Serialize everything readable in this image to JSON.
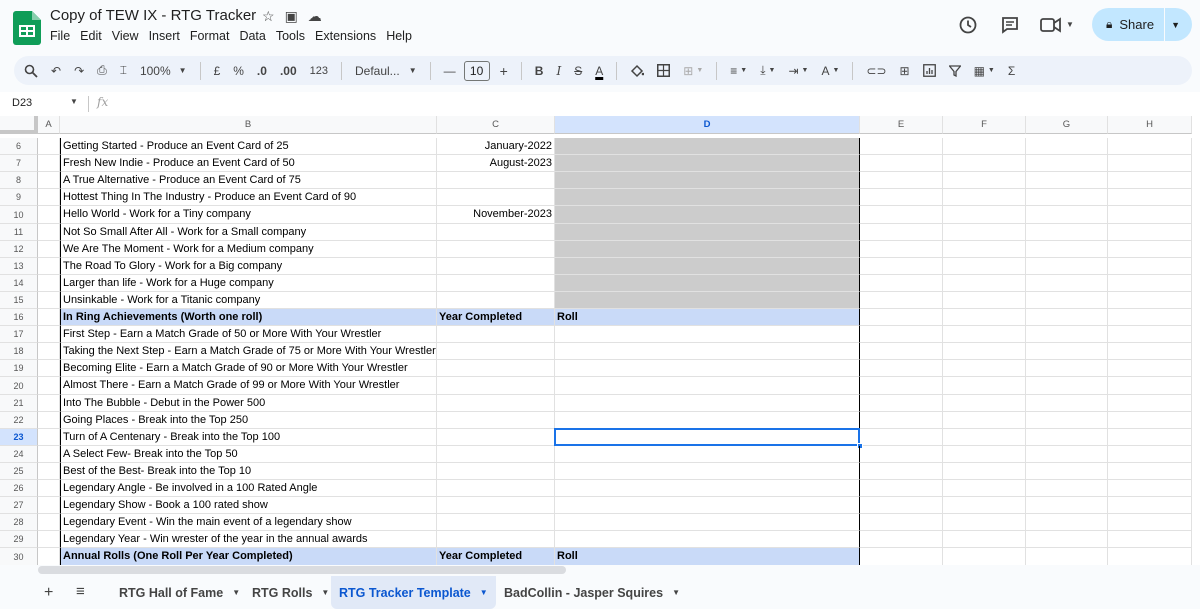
{
  "app": {
    "title": "Copy of TEW IX - RTG Tracker",
    "menu": [
      "File",
      "Edit",
      "View",
      "Insert",
      "Format",
      "Data",
      "Tools",
      "Extensions",
      "Help"
    ],
    "share_label": "Share"
  },
  "toolbar": {
    "zoom": "100%",
    "currency": "£",
    "percent": "%",
    "dec_decrease": ".0",
    "dec_increase": ".00",
    "format_123": "123",
    "font": "Defaul...",
    "font_size": "10",
    "minus": "—",
    "plus": "+",
    "bold": "B",
    "italic": "I",
    "strike": "S",
    "text_color": "A"
  },
  "formula_bar": {
    "cell_ref": "D23",
    "fx": "fx",
    "value": ""
  },
  "columns": [
    {
      "id": "A",
      "selected": false
    },
    {
      "id": "B",
      "selected": false
    },
    {
      "id": "C",
      "selected": false
    },
    {
      "id": "D",
      "selected": true
    },
    {
      "id": "E",
      "selected": false
    },
    {
      "id": "F",
      "selected": false
    },
    {
      "id": "G",
      "selected": false
    },
    {
      "id": "H",
      "selected": false
    }
  ],
  "rows": [
    {
      "n": "6",
      "b": "Getting Started - Produce an Event Card of 25",
      "c": "January-2022",
      "d": "",
      "type": "gray"
    },
    {
      "n": "7",
      "b": "Fresh New Indie - Produce an Event Card of 50",
      "c": "August-2023",
      "d": "",
      "type": "gray"
    },
    {
      "n": "8",
      "b": "A True Alternative - Produce an Event Card of 75",
      "c": "",
      "d": "",
      "type": "gray"
    },
    {
      "n": "9",
      "b": "Hottest Thing In The Industry - Produce an Event Card of 90",
      "c": "",
      "d": "",
      "type": "gray"
    },
    {
      "n": "10",
      "b": "Hello World - Work for a Tiny company",
      "c": "November-2023",
      "d": "",
      "type": "gray"
    },
    {
      "n": "11",
      "b": "Not So Small After All - Work for a Small company",
      "c": "",
      "d": "",
      "type": "gray"
    },
    {
      "n": "12",
      "b": "We Are The Moment - Work for a Medium company",
      "c": "",
      "d": "",
      "type": "gray"
    },
    {
      "n": "13",
      "b": "The Road To Glory - Work for a Big company",
      "c": "",
      "d": "",
      "type": "gray"
    },
    {
      "n": "14",
      "b": "Larger than life - Work for a Huge company",
      "c": "",
      "d": "",
      "type": "gray"
    },
    {
      "n": "15",
      "b": "Unsinkable - Work for a Titanic company",
      "c": "",
      "d": "",
      "type": "gray"
    },
    {
      "n": "16",
      "b": "In Ring Achievements (Worth one roll)",
      "c": "Year Completed",
      "d": "Roll",
      "type": "header"
    },
    {
      "n": "17",
      "b": "First Step - Earn a Match Grade of 50 or More With Your Wrestler",
      "c": "",
      "d": "",
      "type": "normal"
    },
    {
      "n": "18",
      "b": "Taking the Next Step - Earn a Match Grade of 75 or More With Your Wrestler",
      "c": "",
      "d": "",
      "type": "normal"
    },
    {
      "n": "19",
      "b": "Becoming Elite - Earn a Match Grade of 90 or More With Your Wrestler",
      "c": "",
      "d": "",
      "type": "normal"
    },
    {
      "n": "20",
      "b": "Almost There - Earn a Match Grade of 99 or More With Your Wrestler",
      "c": "",
      "d": "",
      "type": "normal"
    },
    {
      "n": "21",
      "b": "Into The Bubble - Debut in the Power 500",
      "c": "",
      "d": "",
      "type": "normal"
    },
    {
      "n": "22",
      "b": "Going Places - Break into the Top 250",
      "c": "",
      "d": "",
      "type": "normal"
    },
    {
      "n": "23",
      "b": "Turn of A Centenary - Break into the Top 100",
      "c": "",
      "d": "",
      "type": "normal"
    },
    {
      "n": "24",
      "b": "A Select Few- Break into the Top 50",
      "c": "",
      "d": "",
      "type": "normal"
    },
    {
      "n": "25",
      "b": "Best of the Best- Break into the Top 10",
      "c": "",
      "d": "",
      "type": "normal"
    },
    {
      "n": "26",
      "b": "Legendary Angle - Be involved in a 100 Rated Angle",
      "c": "",
      "d": "",
      "type": "normal"
    },
    {
      "n": "27",
      "b": "Legendary Show - Book a 100 rated show",
      "c": "",
      "d": "",
      "type": "normal"
    },
    {
      "n": "28",
      "b": "Legendary Event - Win the main event of a legendary show",
      "c": "",
      "d": "",
      "type": "normal"
    },
    {
      "n": "29",
      "b": "Legendary Year - Win wrester of the year in the annual awards",
      "c": "",
      "d": "",
      "type": "normal"
    },
    {
      "n": "30",
      "b": "Annual Rolls (One Roll Per Year Completed)",
      "c": "Year Completed",
      "d": "Roll",
      "type": "header"
    }
  ],
  "selected_row": "23",
  "sheet_tabs": [
    {
      "label": "RTG Hall of Fame",
      "active": false
    },
    {
      "label": "RTG Rolls",
      "active": false
    },
    {
      "label": "RTG Tracker Template",
      "active": true
    },
    {
      "label": "BadCollin - Jasper Squires",
      "active": false
    }
  ],
  "colors": {
    "header_fill": "#c9daf8",
    "gray_fill": "#cccccc",
    "selection": "#1a73e8",
    "share_button": "#c2e7ff"
  }
}
